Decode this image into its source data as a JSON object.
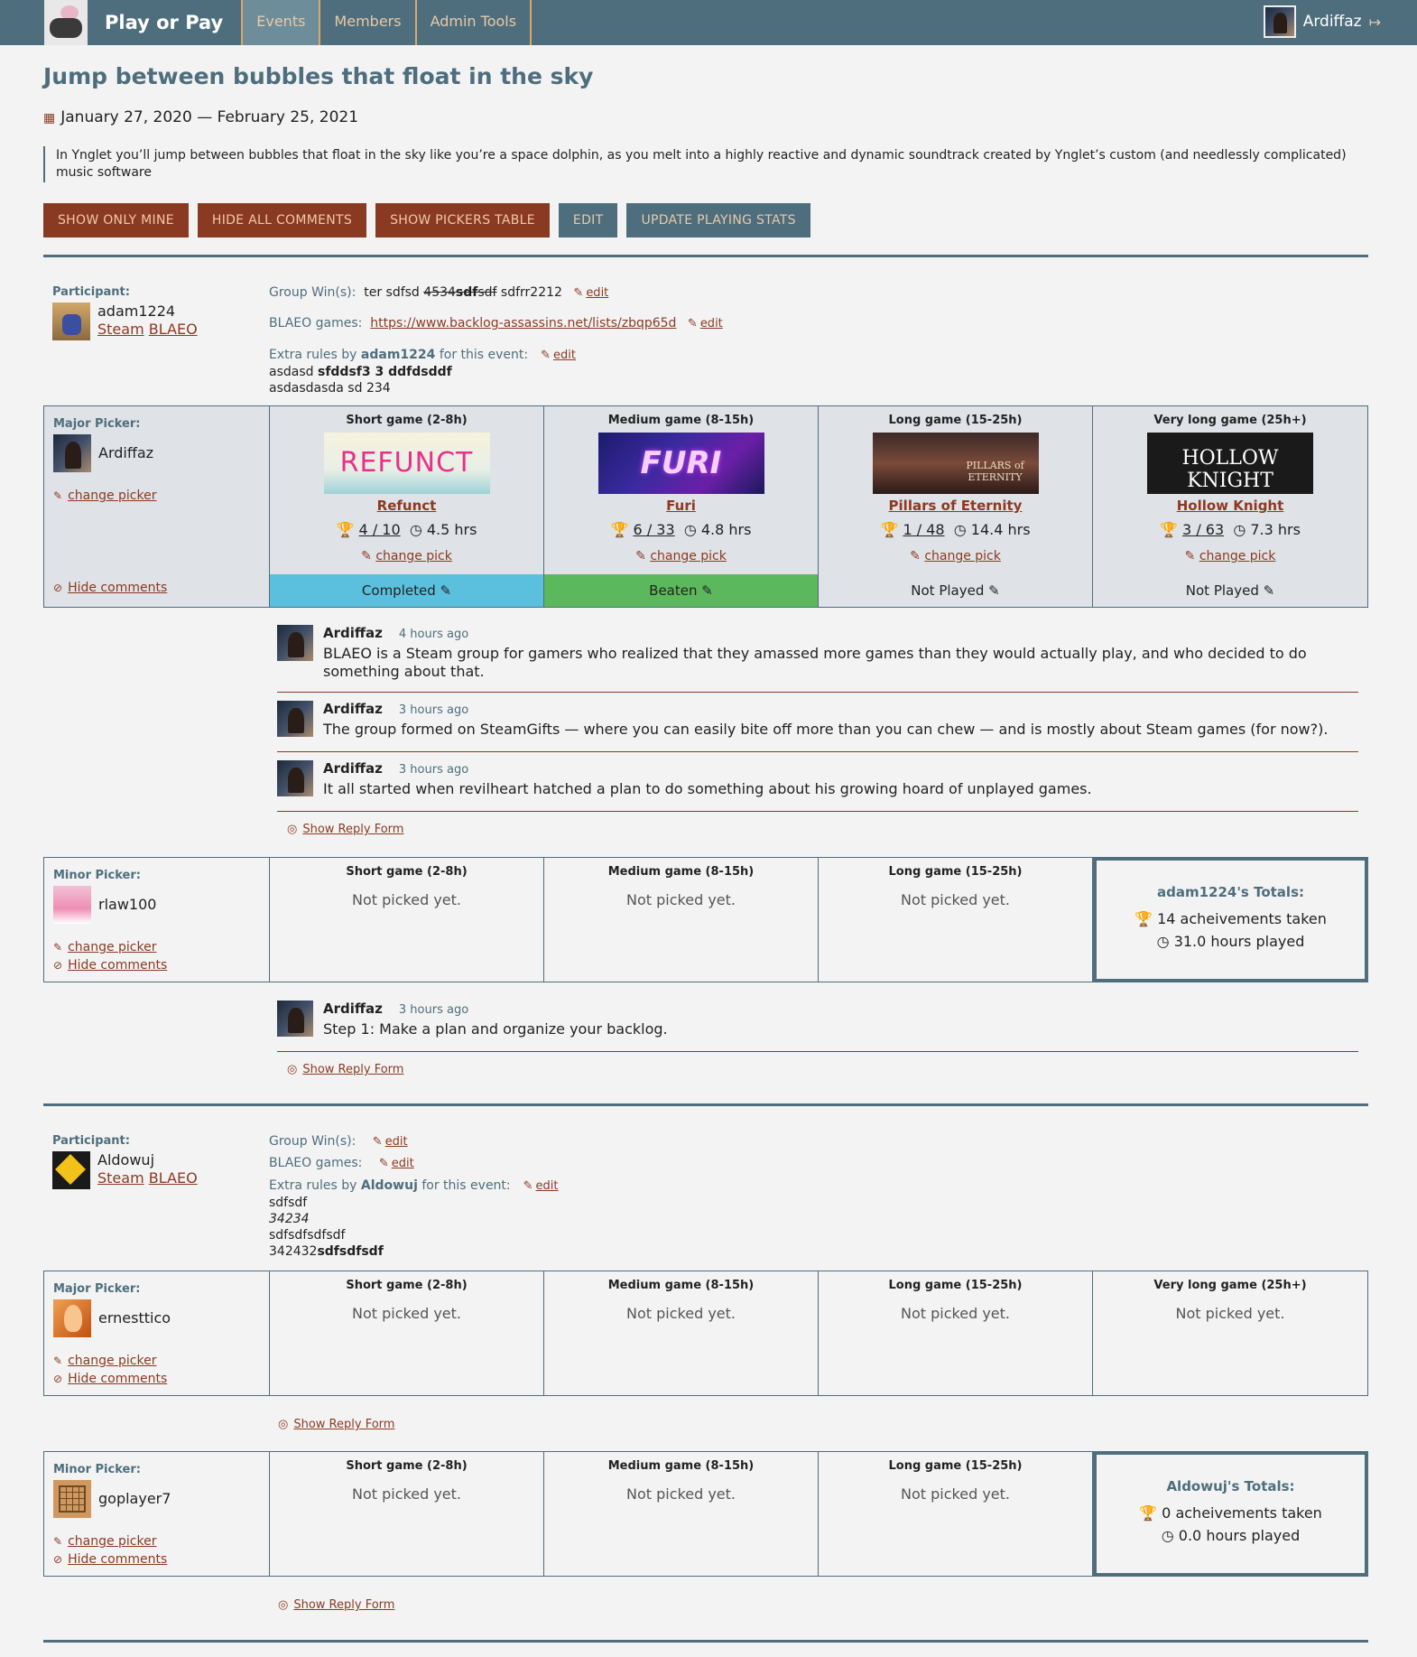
{
  "nav": {
    "brand": "Play or Pay",
    "items": [
      "Events",
      "Members",
      "Admin Tools"
    ],
    "user": "Ardiffaz"
  },
  "event": {
    "title": "Jump between bubbles that float in the sky",
    "dates": "January 27, 2020 — February 25, 2021",
    "description": "In Ynglet you’ll jump between bubbles that float in the sky like you’re a space dolphin, as you melt into a highly reactive and dynamic soundtrack created by Ynglet’s custom (and needlessly complicated) music software"
  },
  "actions": {
    "show_only_mine": "SHOW ONLY MINE",
    "hide_all_comments": "HIDE ALL COMMENTS",
    "show_pickers_table": "SHOW PICKERS TABLE",
    "edit": "EDIT",
    "update_stats": "UPDATE PLAYING STATS"
  },
  "labels": {
    "participant": "Participant:",
    "major_picker": "Major Picker:",
    "minor_picker": "Minor Picker:",
    "group_wins": "Group Win(s):",
    "blaeo_games": "BLAEO games:",
    "extra_rules_prefix": "Extra rules by",
    "extra_rules_suffix": "for this event:",
    "edit": "edit",
    "change_picker": "change picker",
    "hide_comments": "Hide comments",
    "change_pick": "change pick",
    "not_picked": "Not picked yet.",
    "show_reply": "Show Reply Form",
    "steam": "Steam",
    "blaeo": "BLAEO",
    "achievements_taken": "acheivements taken",
    "hours_played": "hours played",
    "slot_short": "Short game (2-8h)",
    "slot_medium": "Medium game (8-15h)",
    "slot_long": "Long game (15-25h)",
    "slot_vlong": "Very long game (25h+)"
  },
  "p1": {
    "name": "adam1224",
    "group_wins_a": "ter sdfsd ",
    "group_wins_strike1": "4534",
    "group_wins_strike_bold": "sdf",
    "group_wins_strike2": "sdf",
    "group_wins_b": " sdfrr2212",
    "blaeo_url": "https://www.backlog-assassins.net/lists/zbqp65d",
    "rules_line1_a": "asdasd ",
    "rules_line1_b": "sfddsf3 3 ddfdsddf",
    "rules_line2": "asdasdasda sd 234",
    "major": "Ardiffaz",
    "minor": "rlaw100",
    "games": [
      {
        "name": "Refunct",
        "ach": "4 / 10",
        "hrs": "4.5 hrs",
        "status": "Completed"
      },
      {
        "name": "Furi",
        "ach": "6 / 33",
        "hrs": "4.8 hrs",
        "status": "Beaten"
      },
      {
        "name": "Pillars of Eternity",
        "ach": "1 / 48",
        "hrs": "14.4 hrs",
        "status": "Not Played"
      },
      {
        "name": "Hollow Knight",
        "ach": "3 / 63",
        "hrs": "7.3 hrs",
        "status": "Not Played"
      }
    ],
    "img_text": [
      "REFUNCT",
      "FURI",
      "PILLARS of ETERNITY",
      "HOLLOW KNIGHT"
    ],
    "totals_title": "adam1224's Totals:",
    "total_ach": "14",
    "total_hrs": "31.0"
  },
  "comments_major": [
    {
      "author": "Ardiffaz",
      "time": "4 hours ago",
      "text": "BLAEO is a Steam group for gamers who realized that they amassed more games than they would actually play, and who decided to do something about that."
    },
    {
      "author": "Ardiffaz",
      "time": "3 hours ago",
      "text": "The group formed on SteamGifts — where you can easily bite off more than you can chew — and is mostly about Steam games (for now?)."
    },
    {
      "author": "Ardiffaz",
      "time": "3 hours ago",
      "text": "It all started when revilheart hatched a plan to do something about his growing hoard of unplayed games."
    }
  ],
  "comments_minor": [
    {
      "author": "Ardiffaz",
      "time": "3 hours ago",
      "text": "Step 1: Make a plan and organize your backlog."
    }
  ],
  "p2": {
    "name": "Aldowuj",
    "rules": [
      "sdfsdf",
      "34234",
      "sdfsdfsdfsdf",
      "342432"
    ],
    "rules_bold": "sdfsdfsdf",
    "major": "ernesttico",
    "minor": "goplayer7",
    "totals_title": "Aldowuj's Totals:",
    "total_ach": "0",
    "total_hrs": "0.0"
  },
  "colors": {
    "brand": "#4e6e7d",
    "accent": "#8b3a22",
    "completed": "#5bc0de",
    "beaten": "#5cb85c"
  }
}
